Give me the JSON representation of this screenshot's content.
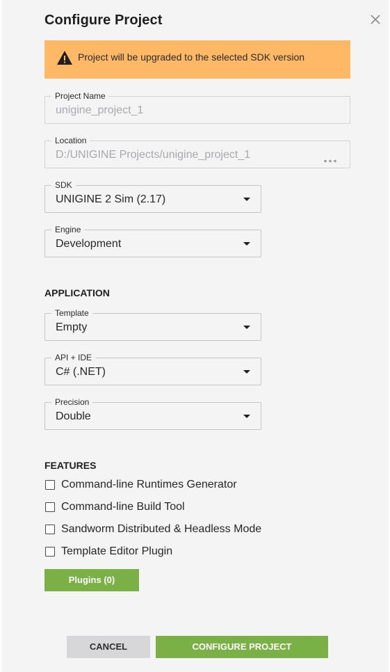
{
  "dialog": {
    "title": "Configure Project",
    "close_icon": "close-icon"
  },
  "banner": {
    "icon": "warning-icon",
    "message": "Project will be upgraded to the selected SDK version",
    "color": "#ffb866"
  },
  "fields": {
    "project_name": {
      "label": "Project Name",
      "value": "unigine_project_1",
      "disabled": true
    },
    "location": {
      "label": "Location",
      "value": "D:/UNIGINE Projects/unigine_project_1",
      "disabled": true,
      "icon": "more-dots-icon"
    },
    "sdk": {
      "label": "SDK",
      "value": "UNIGINE 2 Sim (2.17)"
    },
    "engine": {
      "label": "Engine",
      "value": "Development"
    }
  },
  "application": {
    "heading": "APPLICATION",
    "template": {
      "label": "Template",
      "value": "Empty"
    },
    "api_ide": {
      "label": "API + IDE",
      "value": "C# (.NET)"
    },
    "precision": {
      "label": "Precision",
      "value": "Double"
    }
  },
  "features": {
    "heading": "FEATURES",
    "items": [
      {
        "label": "Command-line Runtimes Generator",
        "checked": false
      },
      {
        "label": "Command-line Build Tool",
        "checked": false
      },
      {
        "label": "Sandworm Distributed & Headless Mode",
        "checked": false
      },
      {
        "label": "Template Editor Plugin",
        "checked": false
      }
    ],
    "plugins_button": "Plugins (0)"
  },
  "footer": {
    "cancel_label": "CANCEL",
    "configure_label": "CONFIGURE PROJECT"
  },
  "colors": {
    "accent_green": "#7bb047",
    "warning_orange": "#ffb866",
    "background": "#f4f4f5"
  }
}
